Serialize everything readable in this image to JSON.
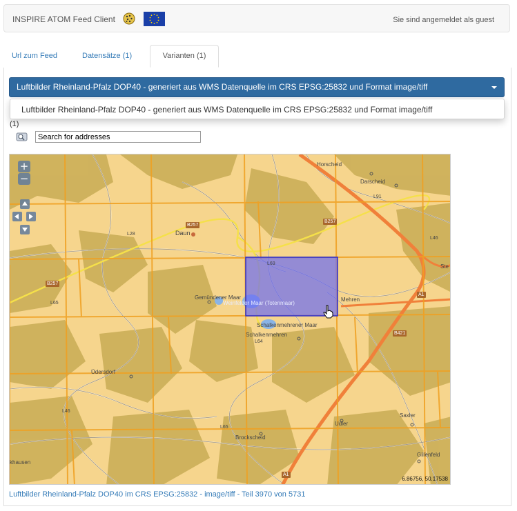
{
  "header": {
    "app_title": "INSPIRE ATOM Feed Client",
    "login_status": "Sie sind angemeldet als guest"
  },
  "tabs": [
    {
      "label": "Url zum Feed",
      "active": false
    },
    {
      "label": "Datensätze (1)",
      "active": false
    },
    {
      "label": "Varianten (1)",
      "active": true
    }
  ],
  "variant_select": {
    "selected": "Luftbilder Rheinland-Pfalz DOP40 - generiert aus WMS Datenquelle im CRS EPSG:25832 und Format image/tiff",
    "options": [
      "Luftbilder Rheinland-Pfalz DOP40 - generiert aus WMS Datenquelle im CRS EPSG:25832 und Format image/tiff"
    ]
  },
  "partial_text": "(1)",
  "search": {
    "placeholder": "Search for addresses",
    "value": "Search for addresses"
  },
  "map": {
    "zoom_in": "+",
    "zoom_out": "−",
    "coordinates": "6.86756, 50.17538",
    "places": {
      "horscheid": "Horscheid",
      "darscheid": "Darscheid",
      "daun": "Daun",
      "gemuendener_maar": "Gemündener Maar",
      "weinfelder_maar": "Weinfelder Maar (Totenmaar)",
      "mehren": "Mehren",
      "schalkenmehrener_maar": "Schalkenmehrener Maar",
      "schalkenmehren": "Schalkenmehren",
      "uedersdorf": "Üdersdorf",
      "saxler": "Saxler",
      "udler": "Udler",
      "brockscheid": "Brockscheid",
      "gillenfeld": "Gillenfeld",
      "khausen": "khausen",
      "ste": "Ste"
    },
    "roads": {
      "b257_a": "B257",
      "b257_b": "B257",
      "b257_c": "B257",
      "b421": "B421",
      "a1_a": "A1",
      "a1_b": "A1",
      "l91": "L91",
      "l64": "L64",
      "l65a": "L65",
      "l65b": "L65",
      "l46a": "L46",
      "l46b": "L46",
      "l69": "L69",
      "l28": "L28"
    }
  },
  "footer": {
    "tile_info": "Luftbilder Rheinland-Pfalz DOP40 im CRS EPSG:25832 - image/tiff - Teil 3970 von 5731"
  },
  "colors": {
    "select_bg": "#2f6aa0",
    "link": "#337ab7",
    "tile_grid": "#f0a020",
    "highlight_tile": "#6b6bf2"
  }
}
